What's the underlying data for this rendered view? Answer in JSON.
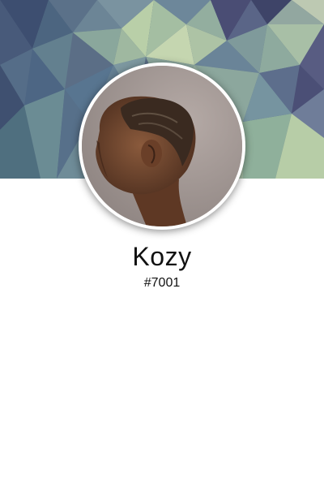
{
  "profile": {
    "name": "Kozy",
    "tag": "#7001"
  },
  "cover": {
    "pattern": "low-poly-geometric",
    "colors": [
      "#3f4f6e",
      "#5d7590",
      "#7e9aa0",
      "#a9c0a3",
      "#c7d6b2",
      "#4a4e73",
      "#6b8398"
    ]
  },
  "avatar": {
    "icon": "user-photo-avatar",
    "ring_color": "#ffffff"
  }
}
